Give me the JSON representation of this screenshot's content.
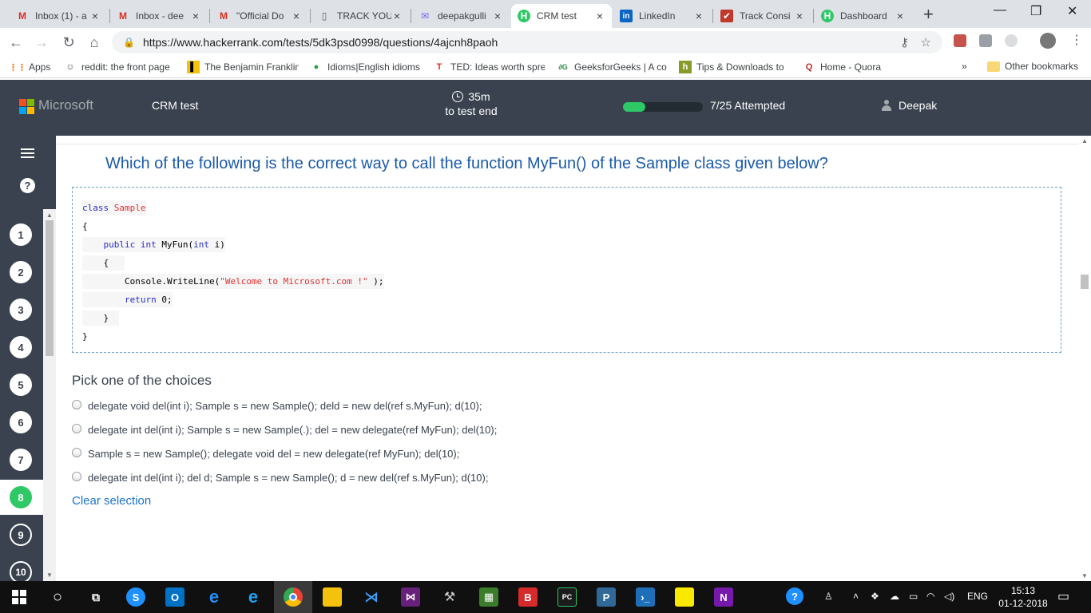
{
  "browser": {
    "tabs": [
      {
        "title": "Inbox (1) - a",
        "icon": "gmail-icon",
        "color": "#d93025",
        "glyph": "M"
      },
      {
        "title": "Inbox - dee",
        "icon": "gmail-icon",
        "color": "#d93025",
        "glyph": "M"
      },
      {
        "title": "\"Official Do",
        "icon": "gmail-icon",
        "color": "#d93025",
        "glyph": "M"
      },
      {
        "title": "TRACK YOU",
        "icon": "document-icon",
        "color": "#5f6368",
        "glyph": "▯"
      },
      {
        "title": "deepakgulli",
        "icon": "mail-icon",
        "color": "#7b68ee",
        "glyph": "✉"
      },
      {
        "title": "CRM test",
        "icon": "hackerrank-icon",
        "color": "#2ec866",
        "glyph": "H"
      },
      {
        "title": "LinkedIn",
        "icon": "linkedin-icon",
        "color": "#0a66c2",
        "glyph": "in"
      },
      {
        "title": "Track Consi",
        "icon": "track-icon",
        "color": "#c0392b",
        "glyph": "✔"
      },
      {
        "title": "Dashboard",
        "icon": "hackerrank-icon",
        "color": "#2ec866",
        "glyph": "H"
      }
    ],
    "new_tab": "+",
    "url": "https://www.hackerrank.com/tests/5dk3psd0998/questions/4ajcnh8paoh",
    "bookmarks": [
      {
        "label": "Apps",
        "icon": "apps-grid-icon",
        "color": "#e8710a",
        "glyph": "⋮⋮"
      },
      {
        "label": "reddit: the front page",
        "icon": "reddit-icon",
        "color": "#555",
        "glyph": "☺"
      },
      {
        "label": "The Benjamin Franklin",
        "icon": "franklin-icon",
        "color": "#f4c20d",
        "glyph": "▌"
      },
      {
        "label": "Idioms|English idioms",
        "icon": "idioms-icon",
        "color": "#2e9e3a",
        "glyph": "●"
      },
      {
        "label": "TED: Ideas worth spre",
        "icon": "ted-icon",
        "color": "#e62b1e",
        "glyph": "T"
      },
      {
        "label": "GeeksforGeeks | A co",
        "icon": "geeksforgeeks-icon",
        "color": "#2f8d46",
        "glyph": "∂G"
      },
      {
        "label": "Tips & Downloads to",
        "icon": "tips-icon",
        "color": "#8a9a2a",
        "glyph": "h"
      },
      {
        "label": "Home - Quora",
        "icon": "quora-icon",
        "color": "#b92b27",
        "glyph": "Q"
      }
    ],
    "bookmarks_overflow": "»",
    "other_bookmarks": "Other bookmarks"
  },
  "header": {
    "brand": "Microsoft",
    "test_name": "CRM test",
    "time_left": "35m",
    "time_caption": "to test end",
    "progress_fraction": 0.28,
    "attempted": "7/25 Attempted",
    "user": "Deepak"
  },
  "sidebar": {
    "questions": [
      "1",
      "2",
      "3",
      "4",
      "5",
      "6",
      "7",
      "8",
      "9",
      "10"
    ],
    "current": "8"
  },
  "question": {
    "text": "Which of the following is the correct way to call the function MyFun() of the Sample class given below?",
    "code": {
      "l1_kw": "class",
      "l1_name": "Sample",
      "l2": "{",
      "l3_kw1": "public",
      "l3_kw2": "int",
      "l3_fn": "MyFun",
      "l3_open": "(",
      "l3_kw3": "int",
      "l3_arg": "i)",
      "l4": "{",
      "l5_call": "Console.WriteLine(",
      "l5_str": "\"Welcome to Microsoft.com !\"",
      "l5_end": ");",
      "l6_kw": "return",
      "l6_val": "0;",
      "l7": "}",
      "l8": "}"
    },
    "choices_title": "Pick one of the choices",
    "choices": [
      "delegate void del(int i); Sample s = new Sample(); deld = new del(ref s.MyFun); d(10);",
      "delegate int del(int i); Sample s = new Sample(.); del = new delegate(ref MyFun); del(10);",
      "Sample s = new Sample(); delegate void del = new delegate(ref MyFun); del(10);",
      "delegate int del(int i); del d; Sample s = new Sample(); d = new del(ref s.MyFun); d(10);"
    ],
    "clear_selection": "Clear selection"
  },
  "taskbar": {
    "language": "ENG",
    "time": "15:13",
    "date": "01-12-2018"
  }
}
